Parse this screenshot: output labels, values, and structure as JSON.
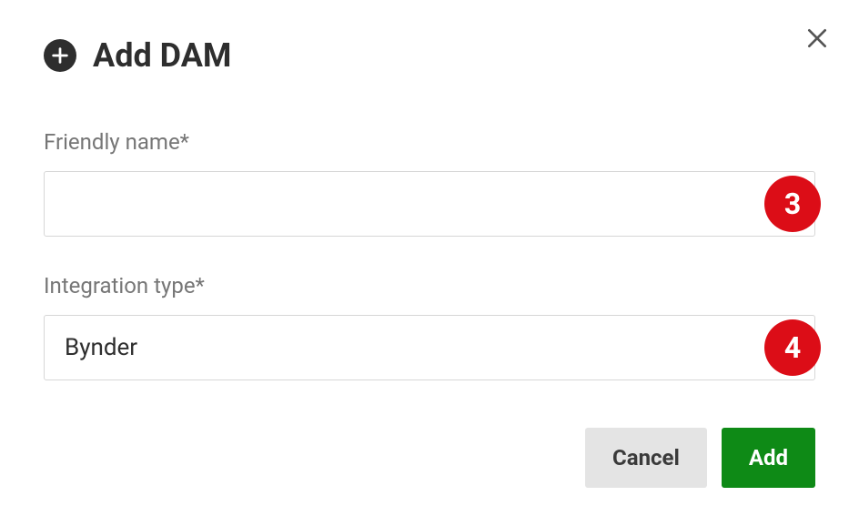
{
  "dialog": {
    "title": "Add DAM",
    "close_label": "Close"
  },
  "form": {
    "friendly_name": {
      "label": "Friendly name*",
      "value": ""
    },
    "integration_type": {
      "label": "Integration type*",
      "value": "Bynder"
    }
  },
  "buttons": {
    "cancel": "Cancel",
    "add": "Add"
  },
  "annotations": {
    "badge1": "3",
    "badge2": "4"
  }
}
